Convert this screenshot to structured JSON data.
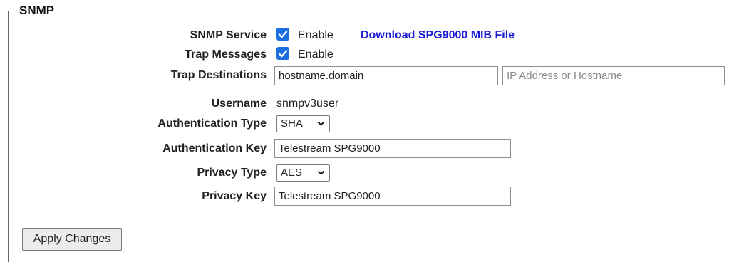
{
  "section": {
    "title": "SNMP"
  },
  "snmp_service": {
    "label": "SNMP Service",
    "checked": true,
    "checkbox_label": "Enable",
    "download_link": "Download SPG9000 MIB File"
  },
  "trap_messages": {
    "label": "Trap Messages",
    "checked": true,
    "checkbox_label": "Enable"
  },
  "trap_destinations": {
    "label": "Trap Destinations",
    "value1": "hostname.domain",
    "placeholder2": "IP Address or Hostname"
  },
  "username": {
    "label": "Username",
    "value": "snmpv3user"
  },
  "auth_type": {
    "label": "Authentication Type",
    "value": "SHA"
  },
  "auth_key": {
    "label": "Authentication Key",
    "value": "Telestream SPG9000"
  },
  "privacy_type": {
    "label": "Privacy Type",
    "value": "AES"
  },
  "privacy_key": {
    "label": "Privacy Key",
    "value": "Telestream SPG9000"
  },
  "apply_button": {
    "label": "Apply Changes"
  },
  "colors": {
    "accent": "#1a6fe0",
    "link": "#1a1ad6"
  }
}
